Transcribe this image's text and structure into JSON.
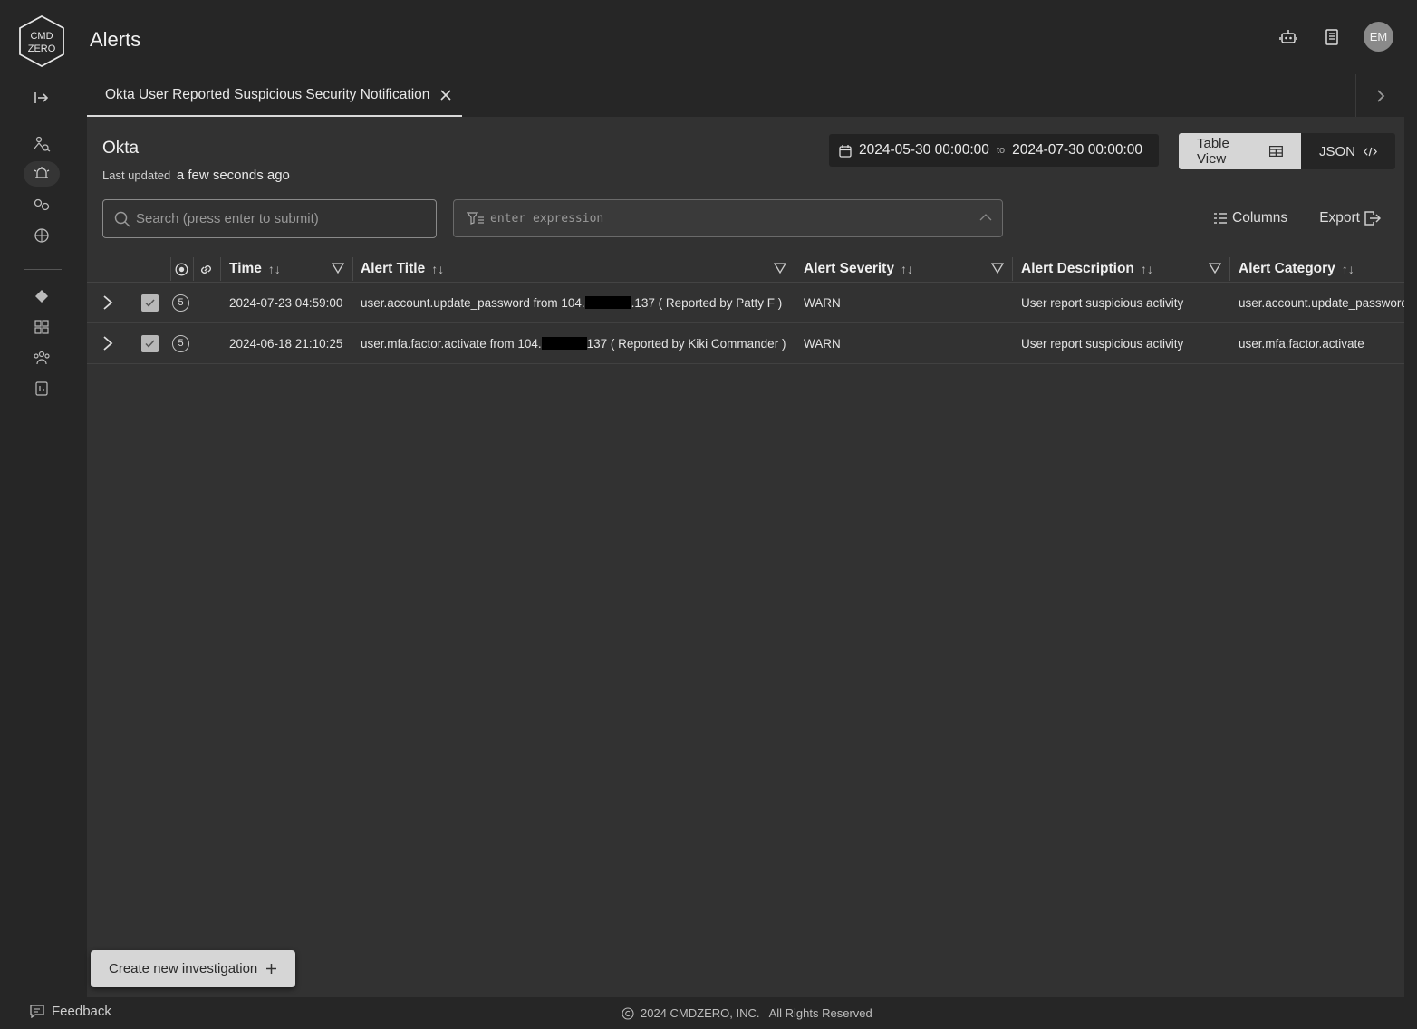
{
  "logo": {
    "text_top": "CMD",
    "text_bottom": "ZERO"
  },
  "header": {
    "title": "Alerts",
    "avatar_initials": "EM"
  },
  "tab": {
    "label": "Okta User Reported Suspicious Security Notification"
  },
  "panel": {
    "title": "Okta",
    "last_updated_label": "Last updated",
    "last_updated_value": "a few seconds ago",
    "date_from": "2024-05-30 00:00:00",
    "date_to_sep": "to",
    "date_to": "2024-07-30 00:00:00",
    "view_table": "Table View",
    "view_json": "JSON",
    "search_placeholder": "Search (press enter to submit)",
    "expression_placeholder": "enter expression",
    "columns_label": "Columns",
    "export_label": "Export"
  },
  "table": {
    "columns": [
      "Time",
      "Alert Title",
      "Alert Severity",
      "Alert Description",
      "Alert Category"
    ],
    "rows": [
      {
        "count": "5",
        "time": "2024-07-23 04:59:00",
        "title_pre": "user.account.update_password from 104.",
        "title_post": ".137 ( Reported by Patty F )",
        "severity": "WARN",
        "description": "User report suspicious activity",
        "category": "user.account.update_password"
      },
      {
        "count": "5",
        "time": "2024-06-18 21:10:25",
        "title_pre": "user.mfa.factor.activate from 104.",
        "title_post": "137 ( Reported by Kiki Commander )",
        "severity": "WARN",
        "description": "User report suspicious activity",
        "category": "user.mfa.factor.activate"
      }
    ]
  },
  "create_investigation": "Create new investigation",
  "feedback": "Feedback",
  "footer": "2024 CMDZERO, INC.   All Rights Reserved"
}
